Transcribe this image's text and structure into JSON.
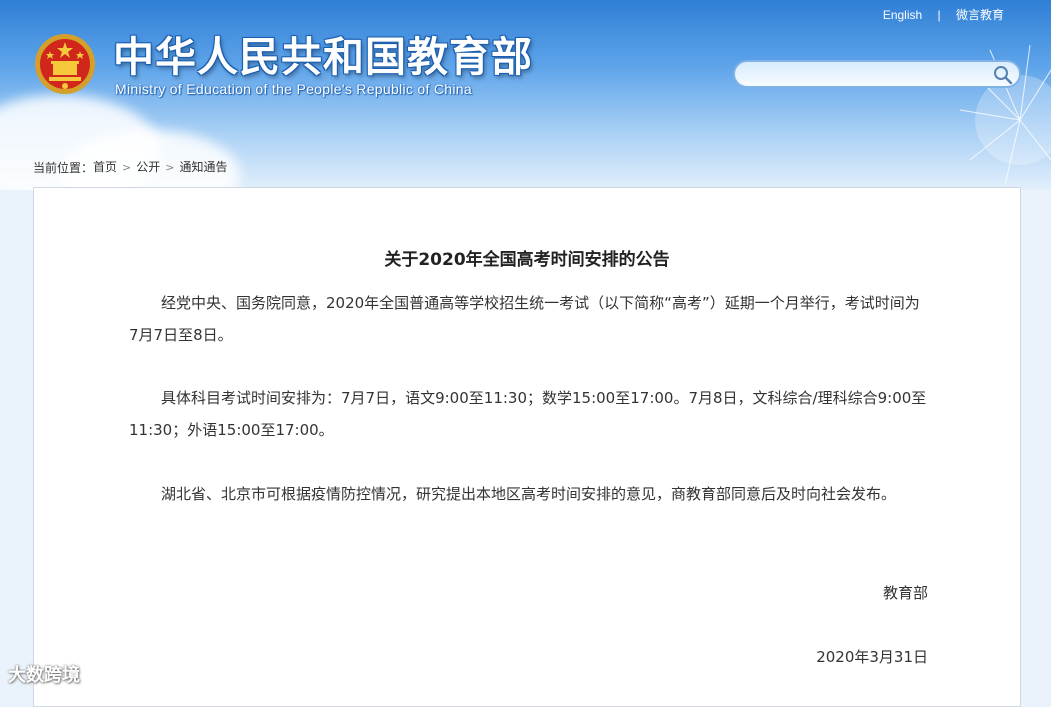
{
  "header": {
    "cn_title": "中华人民共和国教育部",
    "en_title": "Ministry of Education of the People's Republic of China",
    "links": [
      "English",
      "微言教育"
    ],
    "search": {
      "placeholder": "",
      "icon": "search-icon"
    },
    "colors": {
      "sky_top": "#2f7fd6",
      "sky_bottom": "#e2effb"
    }
  },
  "breadcrumb": {
    "prefix": "当前位置：",
    "items": [
      "首页",
      "公开",
      "通知通告"
    ]
  },
  "article": {
    "title": "关于2020年全国高考时间安排的公告",
    "paragraphs": [
      "经党中央、国务院同意，2020年全国普通高等学校招生统一考试（以下简称“高考”）延期一个月举行，考试时间为7月7日至8日。",
      "具体科目考试时间安排为：7月7日，语文9:00至11:30；数学15:00至17:00。7月8日，文科综合/理科综合9:00至11:30；外语15:00至17:00。",
      "湖北省、北京市可根据疫情防控情况，研究提出本地区高考时间安排的意见，商教育部同意后及时向社会发布。"
    ],
    "signature": "教育部",
    "date": "2020年3月31日"
  },
  "watermark": "大数跨境"
}
